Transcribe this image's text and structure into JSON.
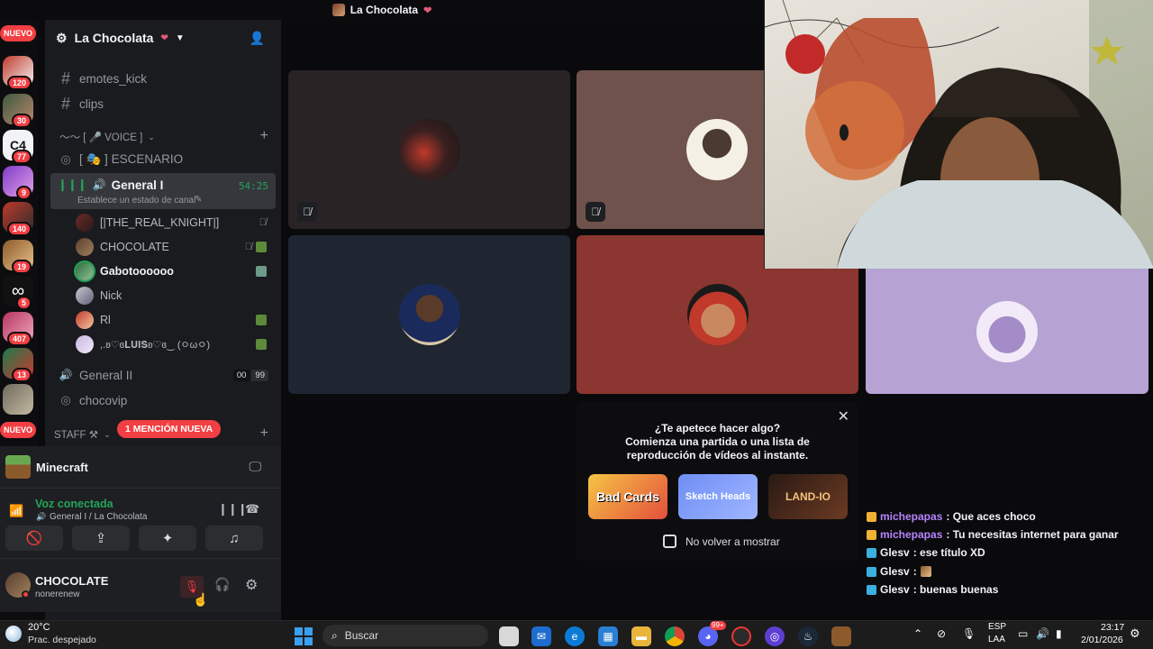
{
  "title": "La Chocolata",
  "rail": {
    "nuevo_top": "NUEVO",
    "nuevo_bottom": "NUEVO",
    "badges": [
      "120",
      "30",
      "77",
      "9",
      "140",
      "19",
      "5",
      "407",
      "13"
    ]
  },
  "server": {
    "name": "La Chocolata"
  },
  "channels": {
    "emotes": "emotes_kick",
    "clips": "clips",
    "voice_category": "〜〜 [ 🎤 VOICE ]",
    "escenario": "[ 🎭 ] ESCENARIO",
    "general_i": "General I",
    "general_i_status": "Establece un estado de canal",
    "general_i_timer": "54:25",
    "general_ii": "General II",
    "general_ii_badges": [
      "00",
      "99"
    ],
    "chocovip": "chocovip",
    "staff_category": "STAFF ⚒",
    "mention_pill": "1 MENCIÓN NUEVA"
  },
  "voice_users": [
    {
      "name": "[|THE_REAL_KNIGHT|]"
    },
    {
      "name": "CHOCOLATE"
    },
    {
      "name": "Gabotoooooo"
    },
    {
      "name": "Nick"
    },
    {
      "name": "Rl"
    },
    {
      "name": ",.ʚ♡ɞ𝐋𝐔𝐈𝐒ʚ♡ɞ‿ (ㅇωㅇ)"
    }
  ],
  "activity": {
    "name": "Minecraft"
  },
  "voice_status": {
    "label": "Voz conectada",
    "channel": "General I / La Chocolata"
  },
  "account": {
    "name": "CHOCOLATE",
    "tag": "nonerenew"
  },
  "popup": {
    "line1": "¿Te apetece hacer algo?",
    "line2": "Comienza una partida o una lista de reproducción de vídeos al instante.",
    "games": [
      "Bad Cards",
      "Sketch Heads",
      "LAND-IO"
    ],
    "checkbox_label": "No volver a mostrar"
  },
  "chat": [
    {
      "user": "michepapas",
      "text": ": Que aces choco",
      "color": "#b784ff"
    },
    {
      "user": "michepapas",
      "text": ": Tu necesitas internet para ganar",
      "color": "#b784ff"
    },
    {
      "user": "Glesv",
      "text": ": ese título XD",
      "color": "#f2f3f5"
    },
    {
      "user": "Glesv",
      "text": ":",
      "color": "#f2f3f5"
    },
    {
      "user": "Glesv",
      "text": ": buenas buenas",
      "color": "#f2f3f5"
    }
  ],
  "taskbar": {
    "weather_temp": "20°C",
    "weather_desc": "Prac. despejado",
    "search": "Buscar",
    "lang_top": "ESP",
    "lang_bottom": "LAA",
    "time": "23:17",
    "date": "2/01/2026",
    "discord_badge": "99+"
  }
}
